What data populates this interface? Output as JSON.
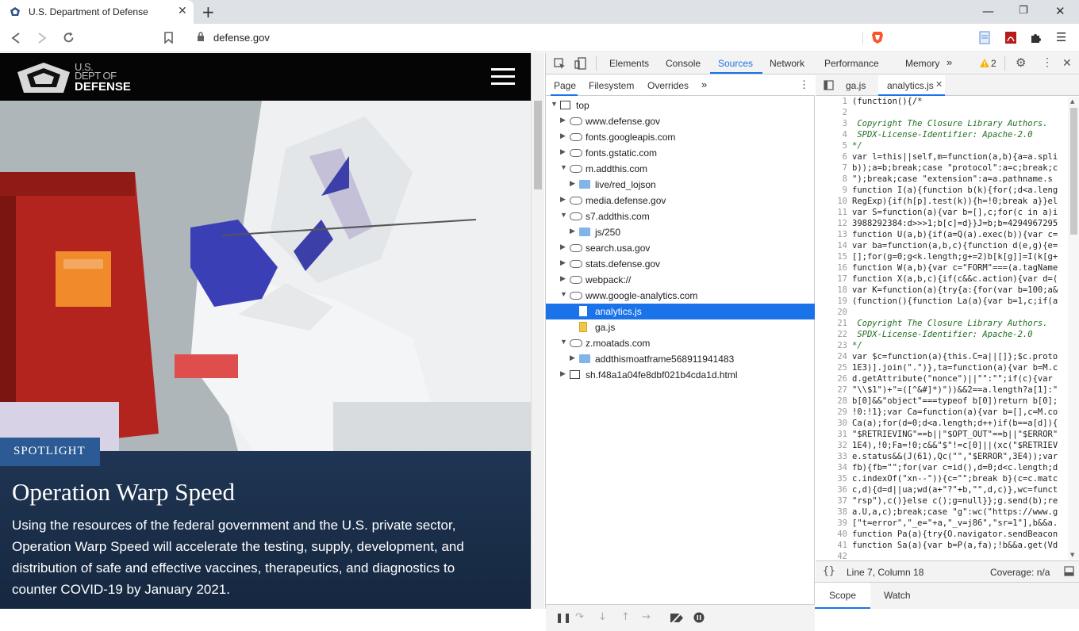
{
  "browser": {
    "tab_title": "U.S. Department of Defense",
    "url": "defense.gov"
  },
  "site": {
    "logo": {
      "line1": "U.S.",
      "line2": "DEPT OF",
      "line3": "DEFENSE"
    },
    "badge": "SPOTLIGHT",
    "headline": "Operation Warp Speed",
    "description": "Using the resources of the federal government and the U.S. private sector, Operation Warp Speed will accelerate the testing, supply, development, and distribution of safe and effective vaccines, therapeutics, and diagnostics to counter COVID-19 by January 2021."
  },
  "devtools": {
    "tabs": [
      "Elements",
      "Console",
      "Sources",
      "Network",
      "Performance",
      "Memory"
    ],
    "active_tab": "Sources",
    "more": "»",
    "warnings": "2",
    "navigator_tabs": [
      "Page",
      "Filesystem",
      "Overrides"
    ],
    "tree": [
      {
        "label": "top",
        "kind": "frame",
        "level": 0,
        "open": true
      },
      {
        "label": "www.defense.gov",
        "kind": "cloud",
        "level": 1,
        "open": false
      },
      {
        "label": "fonts.googleapis.com",
        "kind": "cloud",
        "level": 1,
        "open": false
      },
      {
        "label": "fonts.gstatic.com",
        "kind": "cloud",
        "level": 1,
        "open": false
      },
      {
        "label": "m.addthis.com",
        "kind": "cloud",
        "level": 1,
        "open": true
      },
      {
        "label": "live/red_lojson",
        "kind": "folder",
        "level": 2,
        "open": false
      },
      {
        "label": "media.defense.gov",
        "kind": "cloud",
        "level": 1,
        "open": false
      },
      {
        "label": "s7.addthis.com",
        "kind": "cloud",
        "level": 1,
        "open": true
      },
      {
        "label": "js/250",
        "kind": "folder",
        "level": 2,
        "open": false
      },
      {
        "label": "search.usa.gov",
        "kind": "cloud",
        "level": 1,
        "open": false
      },
      {
        "label": "stats.defense.gov",
        "kind": "cloud",
        "level": 1,
        "open": false
      },
      {
        "label": "webpack://",
        "kind": "cloud",
        "level": 1,
        "open": false
      },
      {
        "label": "www.google-analytics.com",
        "kind": "cloud",
        "level": 1,
        "open": true
      },
      {
        "label": "analytics.js",
        "kind": "file",
        "level": 2,
        "selected": true
      },
      {
        "label": "ga.js",
        "kind": "file-y",
        "level": 2
      },
      {
        "label": "z.moatads.com",
        "kind": "cloud",
        "level": 1,
        "open": true
      },
      {
        "label": "addthismoatframe568911941483",
        "kind": "folder",
        "level": 2,
        "open": false
      },
      {
        "label": "sh.f48a1a04fe8dbf021b4cda1d.html",
        "kind": "frame",
        "level": 1,
        "open": false
      }
    ],
    "editor_tabs": [
      "ga.js",
      "analytics.js"
    ],
    "code": [
      {
        "n": "1",
        "t": "(function(){/*",
        "c": false
      },
      {
        "n": "2",
        "t": "",
        "c": false
      },
      {
        "n": "3",
        "t": " Copyright The Closure Library Authors.",
        "c": true
      },
      {
        "n": "4",
        "t": " SPDX-License-Identifier: Apache-2.0",
        "c": true
      },
      {
        "n": "5",
        "t": "*/",
        "c": true
      },
      {
        "n": "6",
        "t": "var l=this||self,m=function(a,b){a=a.spli",
        "c": false
      },
      {
        "n": "7",
        "t": "b));a=b;break;case \"protocol\":a=c;break;c",
        "c": false
      },
      {
        "n": "8",
        "t": "\");break;case \"extension\":a=a.pathname.s",
        "c": false
      },
      {
        "n": "9",
        "t": "function I(a){function b(k){for(;d<a.leng",
        "c": false
      },
      {
        "n": "10",
        "t": "RegExp){if(h[p].test(k)){h=!0;break a}}el",
        "c": false
      },
      {
        "n": "11",
        "t": "var S=function(a){var b=[],c;for(c in a)i",
        "c": false
      },
      {
        "n": "12",
        "t": "3988292384:d>>>1;b[c]=d}}J=b;b=4294967295",
        "c": false
      },
      {
        "n": "13",
        "t": "function U(a,b){if(a=Q(a).exec(b)){var c=",
        "c": false
      },
      {
        "n": "14",
        "t": "var ba=function(a,b,c){function d(e,g){e=",
        "c": false
      },
      {
        "n": "15",
        "t": "[];for(g=0;g<k.length;g+=2)b[k[g]]=I(k[g+",
        "c": false
      },
      {
        "n": "16",
        "t": "function W(a,b){var c=\"FORM\"===(a.tagName",
        "c": false
      },
      {
        "n": "17",
        "t": "function X(a,b,c){if(c&&c.action){var d=(",
        "c": false
      },
      {
        "n": "18",
        "t": "var K=function(a){try{a:{for(var b=100;a&",
        "c": false
      },
      {
        "n": "19",
        "t": "(function(){function La(a){var b=1,c;if(a",
        "c": false
      },
      {
        "n": "20",
        "t": "",
        "c": false
      },
      {
        "n": "21",
        "t": " Copyright The Closure Library Authors.",
        "c": true
      },
      {
        "n": "22",
        "t": " SPDX-License-Identifier: Apache-2.0",
        "c": true
      },
      {
        "n": "23",
        "t": "*/",
        "c": true
      },
      {
        "n": "24",
        "t": "var $c=function(a){this.C=a||[]};$c.proto",
        "c": false
      },
      {
        "n": "25",
        "t": "1E3)].join(\".\")},ta=function(a){var b=M.c",
        "c": false
      },
      {
        "n": "26",
        "t": "d.getAttribute(\"nonce\")||\"\":\"\";if(c){var ",
        "c": false
      },
      {
        "n": "27",
        "t": "\"\\\\$1\")+\"=([^&#]*)\"))&&2==a.length?a[1]:\"",
        "c": false
      },
      {
        "n": "28",
        "t": "b[0]&&\"object\"===typeof b[0])return b[0];",
        "c": false
      },
      {
        "n": "29",
        "t": "!0:!1};var Ca=function(a){var b=[],c=M.co",
        "c": false
      },
      {
        "n": "30",
        "t": "Ca(a);for(d=0;d<a.length;d++)if(b==a[d]){",
        "c": false
      },
      {
        "n": "31",
        "t": "\"$RETRIEVING\"==b||\"$OPT_OUT\"==b||\"$ERROR\"",
        "c": false
      },
      {
        "n": "32",
        "t": "1E4),!0;Fa=!0;c&&\"$\"!=c[0]||(xc(\"$RETRIEV",
        "c": false
      },
      {
        "n": "33",
        "t": "e.status&&(J(61),Qc(\"\",\"$ERROR\",3E4));var",
        "c": false
      },
      {
        "n": "34",
        "t": "fb){fb=\"\";for(var c=id(),d=0;d<c.length;d",
        "c": false
      },
      {
        "n": "35",
        "t": "c.indexOf(\"xn--\")){c=\"\";break b}(c=c.matc",
        "c": false
      },
      {
        "n": "36",
        "t": "c,d){d=d||ua;wd(a+\"?\"+b,\"\",d,c)},wc=funct",
        "c": false
      },
      {
        "n": "37",
        "t": "\"rsp\"),c()}else c();g=null}};g.send(b);re",
        "c": false
      },
      {
        "n": "38",
        "t": "a.U,a,c);break;case \"g\":wc(\"https://www.g",
        "c": false
      },
      {
        "n": "39",
        "t": "[\"t=error\",\"_e=\"+a,\"_v=j86\",\"sr=1\"],b&&a.",
        "c": false
      },
      {
        "n": "40",
        "t": "function Pa(a){try{O.navigator.sendBeacon",
        "c": false
      },
      {
        "n": "41",
        "t": "function Sa(a){var b=P(a,fa);!b&&a.get(Vd",
        "c": false
      },
      {
        "n": "42",
        "t": "",
        "c": false
      }
    ],
    "status": {
      "position": "Line 7, Column 18",
      "coverage": "Coverage: n/a",
      "braces": "{}"
    },
    "bottom_tabs": [
      "Scope",
      "Watch"
    ]
  }
}
